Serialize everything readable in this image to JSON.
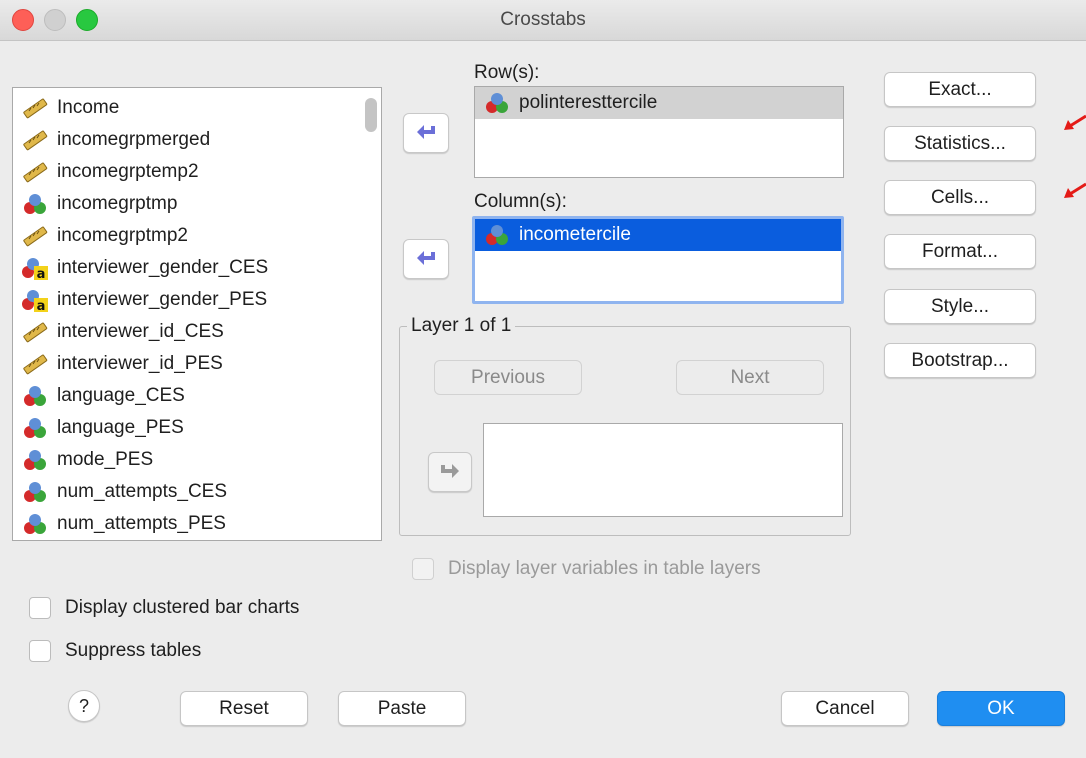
{
  "window": {
    "title": "Crosstabs"
  },
  "variables": [
    {
      "name": "Income",
      "type": "scale"
    },
    {
      "name": "incomegrpmerged",
      "type": "scale"
    },
    {
      "name": "incomegrptemp2",
      "type": "scale"
    },
    {
      "name": "incomegrptmp",
      "type": "nominal"
    },
    {
      "name": "incomegrptmp2",
      "type": "scale"
    },
    {
      "name": "interviewer_gender_CES",
      "type": "string"
    },
    {
      "name": "interviewer_gender_PES",
      "type": "string"
    },
    {
      "name": "interviewer_id_CES",
      "type": "scale"
    },
    {
      "name": "interviewer_id_PES",
      "type": "scale"
    },
    {
      "name": "language_CES",
      "type": "nominal"
    },
    {
      "name": "language_PES",
      "type": "nominal"
    },
    {
      "name": "mode_PES",
      "type": "nominal"
    },
    {
      "name": "num_attempts_CES",
      "type": "nominal"
    },
    {
      "name": "num_attempts_PES",
      "type": "nominal"
    },
    {
      "name": "",
      "type": "scale"
    }
  ],
  "rows": {
    "label": "Row(s):",
    "items": [
      "polinteresttercile"
    ]
  },
  "columns": {
    "label": "Column(s):",
    "items": [
      "incometercile"
    ]
  },
  "layer": {
    "legend": "Layer 1 of 1",
    "previous_label": "Previous",
    "next_label": "Next"
  },
  "side_buttons": {
    "exact": "Exact...",
    "statistics": "Statistics...",
    "cells": "Cells...",
    "format": "Format...",
    "style": "Style...",
    "bootstrap": "Bootstrap..."
  },
  "options": {
    "display_layer_vars": "Display layer variables in table layers",
    "clustered_bar": "Display clustered bar charts",
    "suppress_tables": "Suppress tables"
  },
  "footer": {
    "help": "?",
    "reset": "Reset",
    "paste": "Paste",
    "cancel": "Cancel",
    "ok": "OK"
  },
  "colors": {
    "selection_blue": "#0a5dde",
    "ok_blue": "#1f8ef1",
    "annotation_red": "#e41b17",
    "arrow_purple": "#6b6fd8"
  }
}
